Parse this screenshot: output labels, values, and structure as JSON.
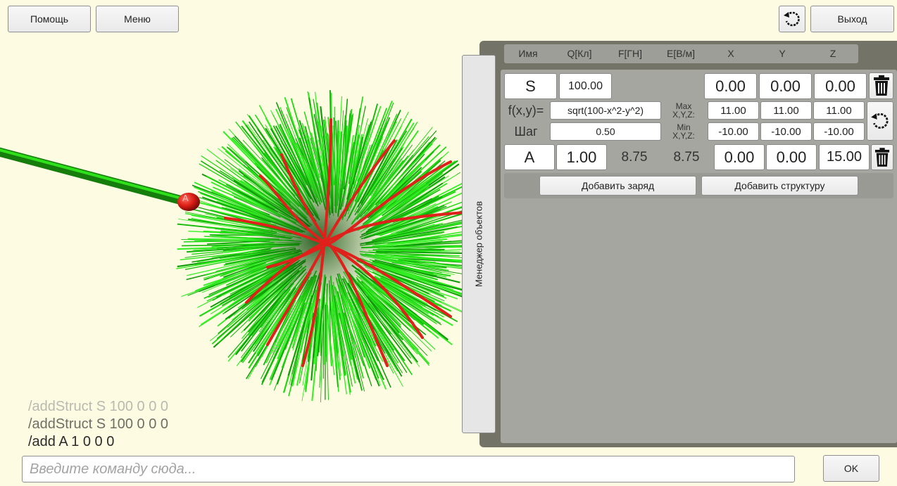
{
  "toolbar": {
    "help_label": "Помощь",
    "menu_label": "Меню",
    "exit_label": "Выход",
    "reset_icon": "rotate-ccw-icon"
  },
  "scene": {
    "charge_label": "A",
    "field_color": "#22dd11",
    "surface_color": "#e0201a",
    "charge_color": "#d81c14"
  },
  "manager_tab_label": "Менеджер объектов",
  "table": {
    "headers": [
      "Имя",
      "Q[Кл]",
      "F[ГН]",
      "E[В/м]",
      "X",
      "Y",
      "Z"
    ],
    "structure": {
      "name": "S",
      "q": "100.00",
      "x": "0.00",
      "y": "0.00",
      "z": "0.00",
      "func_label": "f(x,y)=",
      "func": "sqrt(100-x^2-y^2)",
      "step_label": "Шаг",
      "step": "0.50",
      "max_label_1": "Max",
      "max_label_2": "X,Y,Z:",
      "min_label_1": "Min",
      "min_label_2": "X,Y,Z:",
      "max": [
        "11.00",
        "11.00",
        "11.00"
      ],
      "min": [
        "-10.00",
        "-10.00",
        "-10.00"
      ]
    },
    "charge": {
      "name": "A",
      "q": "1.00",
      "f": "8.75",
      "e": "8.75",
      "x": "0.00",
      "y": "0.00",
      "z": "15.00"
    },
    "add_charge_label": "Добавить заряд",
    "add_structure_label": "Добавить структуру"
  },
  "log": [
    "/addStruct S 100 0 0 0",
    "/addStruct S 100 0 0 0",
    "/add A 1 0 0 0"
  ],
  "command": {
    "placeholder": "Введите команду сюда...",
    "ok_label": "OK"
  }
}
